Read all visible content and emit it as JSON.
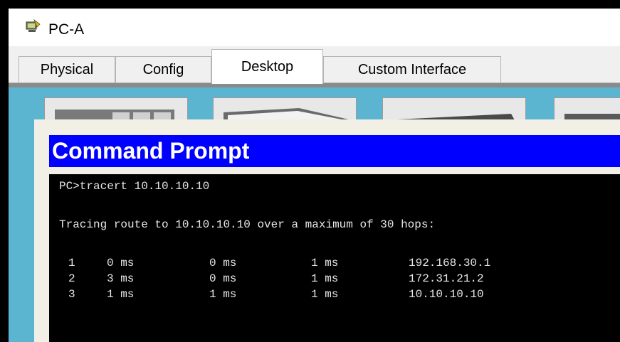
{
  "window": {
    "title": "PC-A",
    "icon": "pc-app-icon"
  },
  "tabs": [
    {
      "label": "Physical",
      "active": false
    },
    {
      "label": "Config",
      "active": false
    },
    {
      "label": "Desktop",
      "active": true
    },
    {
      "label": "Custom Interface",
      "active": false
    }
  ],
  "command_prompt": {
    "title": "Command Prompt",
    "command_line": "PC>tracert 10.10.10.10",
    "tracing_line": "Tracing route to 10.10.10.10 over a maximum of 30 hops:",
    "hops": [
      {
        "hop": "1",
        "t1": "0 ms",
        "t2": "0 ms",
        "t3": "1 ms",
        "address": "192.168.30.1"
      },
      {
        "hop": "2",
        "t1": "3 ms",
        "t2": "0 ms",
        "t3": "1 ms",
        "address": "172.31.21.2"
      },
      {
        "hop": "3",
        "t1": "1 ms",
        "t2": "1 ms",
        "t3": "1 ms",
        "address": "10.10.10.10"
      }
    ]
  },
  "colors": {
    "outer_frame": "#000000",
    "desktop_bg": "#5bb5d0",
    "header_bg": "#0000ff",
    "terminal_bg": "#000000",
    "terminal_text": "#e6e6e6"
  }
}
